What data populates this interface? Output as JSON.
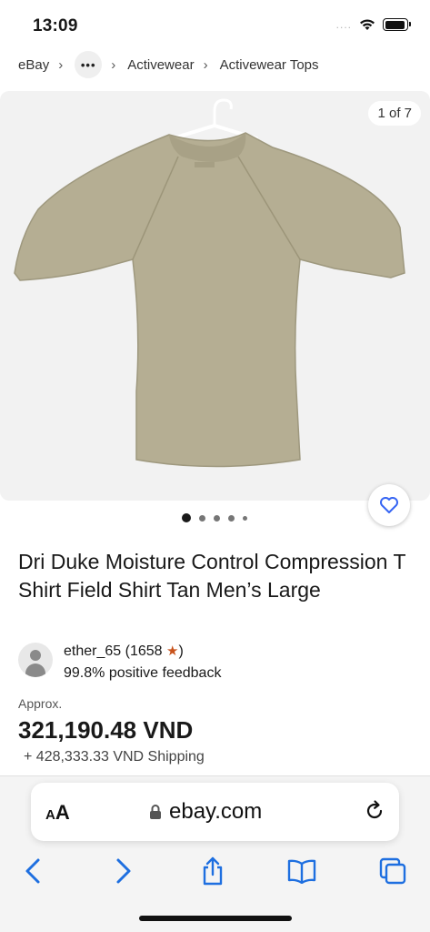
{
  "status_bar": {
    "time": "13:09",
    "signal": "....",
    "wifi_icon": "wifi-icon",
    "battery_icon": "battery-icon"
  },
  "breadcrumb": {
    "items": [
      "eBay",
      "Activewear",
      "Activewear Tops"
    ],
    "more_label": "•••"
  },
  "gallery": {
    "counter": "1 of 7",
    "image_icon": "tan-tshirt-on-hanger-image",
    "dots_count": 5,
    "active_dot": 0
  },
  "listing": {
    "title": "Dri Duke Moisture Control Compression T Shirt Field Shirt Tan Men’s Large"
  },
  "seller": {
    "name": "ether_65",
    "feedback_count_open": "(1658",
    "feedback_count_close": ")",
    "positive": "99.8% positive feedback",
    "star_color": "#c8531c"
  },
  "price": {
    "approx_label": "Approx.",
    "amount": "321,190.48 VND",
    "shipping": "+ 428,333.33 VND Shipping"
  },
  "browser": {
    "aa_small": "A",
    "aa_large": "A",
    "url": "ebay.com",
    "accent": "#1e6fe0"
  }
}
